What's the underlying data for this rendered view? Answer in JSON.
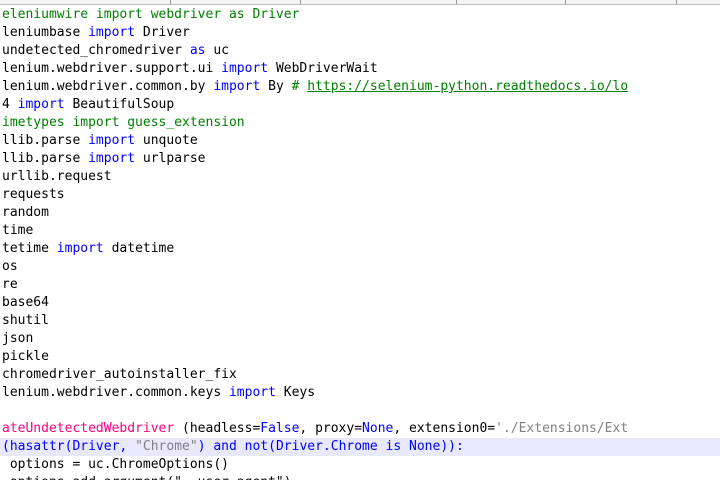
{
  "editor": {
    "lines": [
      {
        "segments": [
          {
            "text": "eleniumwire import webdriver as Driver",
            "class": "kw-green"
          }
        ]
      },
      {
        "segments": [
          {
            "text": "leniumbase ",
            "class": ""
          },
          {
            "text": "import",
            "class": "kw"
          },
          {
            "text": " Driver",
            "class": ""
          }
        ]
      },
      {
        "segments": [
          {
            "text": "undetected_chromedriver ",
            "class": ""
          },
          {
            "text": "as",
            "class": "kw"
          },
          {
            "text": " uc",
            "class": ""
          }
        ]
      },
      {
        "segments": [
          {
            "text": "lenium.webdriver.support.ui ",
            "class": ""
          },
          {
            "text": "import",
            "class": "kw"
          },
          {
            "text": " WebDriverWait",
            "class": ""
          }
        ]
      },
      {
        "segments": [
          {
            "text": "lenium.webdriver.common.by ",
            "class": ""
          },
          {
            "text": "import",
            "class": "kw"
          },
          {
            "text": " By ",
            "class": ""
          },
          {
            "text": "# ",
            "class": "com"
          },
          {
            "text": "https://selenium-python.readthedocs.io/lo",
            "class": "link"
          }
        ]
      },
      {
        "segments": [
          {
            "text": "4 ",
            "class": ""
          },
          {
            "text": "import",
            "class": "kw"
          },
          {
            "text": " BeautifulSoup",
            "class": ""
          }
        ]
      },
      {
        "segments": [
          {
            "text": "imetypes import guess_extension",
            "class": "kw-green"
          }
        ]
      },
      {
        "segments": [
          {
            "text": "llib.parse ",
            "class": ""
          },
          {
            "text": "import",
            "class": "kw"
          },
          {
            "text": " unquote",
            "class": ""
          }
        ]
      },
      {
        "segments": [
          {
            "text": "llib.parse ",
            "class": ""
          },
          {
            "text": "import",
            "class": "kw"
          },
          {
            "text": " urlparse",
            "class": ""
          }
        ]
      },
      {
        "segments": [
          {
            "text": "urllib.request",
            "class": ""
          }
        ]
      },
      {
        "segments": [
          {
            "text": "requests",
            "class": ""
          }
        ]
      },
      {
        "segments": [
          {
            "text": "random",
            "class": ""
          }
        ]
      },
      {
        "segments": [
          {
            "text": "time",
            "class": ""
          }
        ]
      },
      {
        "segments": [
          {
            "text": "tetime ",
            "class": ""
          },
          {
            "text": "import",
            "class": "kw"
          },
          {
            "text": " datetime",
            "class": ""
          }
        ]
      },
      {
        "segments": [
          {
            "text": "os",
            "class": ""
          }
        ]
      },
      {
        "segments": [
          {
            "text": "re",
            "class": ""
          }
        ]
      },
      {
        "segments": [
          {
            "text": "base64",
            "class": ""
          }
        ]
      },
      {
        "segments": [
          {
            "text": "shutil",
            "class": ""
          }
        ]
      },
      {
        "segments": [
          {
            "text": "json",
            "class": ""
          }
        ]
      },
      {
        "segments": [
          {
            "text": "pickle",
            "class": ""
          }
        ]
      },
      {
        "segments": [
          {
            "text": "chromedriver_autoinstaller_fix",
            "class": ""
          }
        ]
      },
      {
        "segments": [
          {
            "text": "lenium.webdriver.common.keys ",
            "class": ""
          },
          {
            "text": "import",
            "class": "kw"
          },
          {
            "text": " Keys",
            "class": ""
          }
        ]
      },
      {
        "segments": [
          {
            "text": "",
            "class": ""
          }
        ]
      },
      {
        "segments": [
          {
            "text": "ateUndetectedWebdriver",
            "class": "fn"
          },
          {
            "text": " (headless=",
            "class": ""
          },
          {
            "text": "False",
            "class": "kw"
          },
          {
            "text": ", proxy=",
            "class": ""
          },
          {
            "text": "None",
            "class": "kw"
          },
          {
            "text": ", extension0=",
            "class": ""
          },
          {
            "text": "'./Extensions/Ext",
            "class": "str"
          }
        ]
      },
      {
        "current": true,
        "segments": [
          {
            "text": "(hasattr(Driver, ",
            "class": "kw"
          },
          {
            "text": "\"Chrome\"",
            "class": "str"
          },
          {
            "text": ") ",
            "class": "kw"
          },
          {
            "text": "and not",
            "class": "kw"
          },
          {
            "text": "(Driver.Chrome ",
            "class": "kw"
          },
          {
            "text": "is None",
            "class": "kw"
          },
          {
            "text": ")):",
            "class": "kw"
          }
        ]
      },
      {
        "segments": [
          {
            "text": " options = uc.ChromeOptions()",
            "class": ""
          }
        ]
      },
      {
        "cut": true,
        "segments": [
          {
            "text": " options.add_argument(\"--user-agent\")",
            "class": ""
          }
        ]
      }
    ]
  }
}
